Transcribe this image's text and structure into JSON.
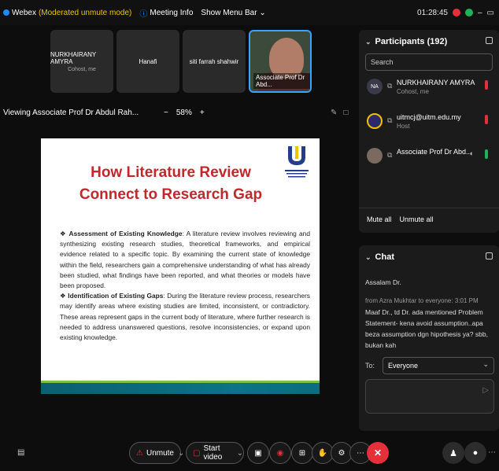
{
  "topbar": {
    "app_name": "Webex",
    "mode": "(Moderated unmute mode)",
    "meeting_info": "Meeting Info",
    "show_menu_bar": "Show Menu Bar",
    "time": "01:28:45"
  },
  "tiles": [
    {
      "name": "NURKHAIRANY AMYRA",
      "role": "Cohost, me"
    },
    {
      "name": "Hanafi",
      "role": ""
    },
    {
      "name": "siti farrah shahwir",
      "role": ""
    },
    {
      "name": "Associate Prof Dr Abd...",
      "role": ""
    }
  ],
  "viewing": {
    "label": "Viewing Associate Prof Dr Abdul Rah...",
    "minus": "−",
    "zoom": "58%",
    "plus": "+"
  },
  "slide": {
    "title": "How Literature Review Connect to Research Gap",
    "bullet1_head": "Assessment of Existing Knowledge",
    "bullet1_text": ": A literature review involves reviewing and synthesizing existing research studies, theoretical frameworks, and empirical evidence related to a specific topic. By examining the current state of knowledge within the field, researchers gain a comprehensive understanding of what has already been studied, what findings have been reported, and what theories or models have been proposed.",
    "bullet2_head": "Identification of Existing Gaps",
    "bullet2_text": ": During the literature review process, researchers may identify areas where existing studies are limited, inconsistent, or contradictory. These areas represent gaps in the current body of literature, where further research is needed to address unanswered questions, resolve inconsistencies, or expand upon existing knowledge."
  },
  "participants": {
    "title": "Participants (192)",
    "search_placeholder": "Search",
    "people": [
      {
        "initials": "NA",
        "name": "NURKHAIRANY AMYRA",
        "role": "Cohost, me"
      },
      {
        "initials": "",
        "name": "uitmcj@uitm.edu.my",
        "role": "Host"
      },
      {
        "initials": "",
        "name": "Associate Prof Dr Abd...",
        "role": ""
      }
    ],
    "mute_all": "Mute all",
    "unmute_all": "Unmute all"
  },
  "chat": {
    "title": "Chat",
    "prev_line": "Assalam Dr.",
    "meta": "from Azra Mukhtar to everyone:   3:01 PM",
    "message": "Maaf Dr., td Dr. ada mentioned Problem Statement- kena avoid assumption..apa beza assumption dgn hipothesis ya? sbb, bukan kah",
    "to_label": "To:",
    "to_value": "Everyone"
  },
  "controls": {
    "unmute": "Unmute",
    "start_video": "Start video"
  },
  "colors": {
    "accent": "#3aa2ff",
    "danger": "#e5303a",
    "ok": "#1fb25a",
    "slide_title": "#c0282d"
  }
}
